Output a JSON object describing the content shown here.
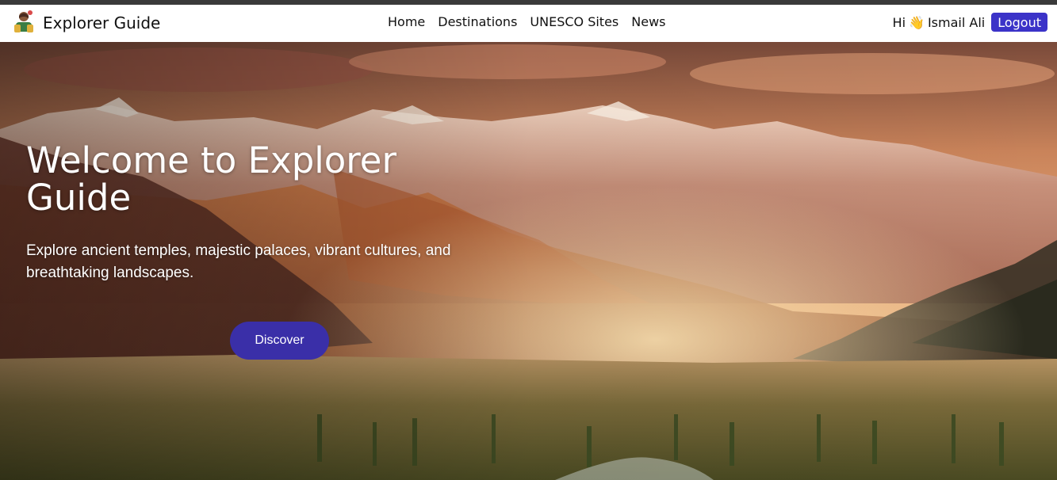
{
  "brand": {
    "name": "Explorer Guide",
    "logo_icon": "explorer-avatar-icon"
  },
  "nav": {
    "links": [
      "Home",
      "Destinations",
      "UNESCO Sites",
      "News"
    ]
  },
  "user": {
    "greeting": "Hi",
    "wave_icon": "👋",
    "name": "Ismail Ali",
    "logout_label": "Logout"
  },
  "hero": {
    "title": "Welcome to Explorer Guide",
    "subtitle": "Explore ancient temples, majestic palaces, vibrant cultures, and breathtaking landscapes.",
    "cta_label": "Discover"
  },
  "colors": {
    "accent": "#3b33c8",
    "cta": "#3a2fa8",
    "navbar_bg": "#ffffff",
    "text": "#111111"
  }
}
